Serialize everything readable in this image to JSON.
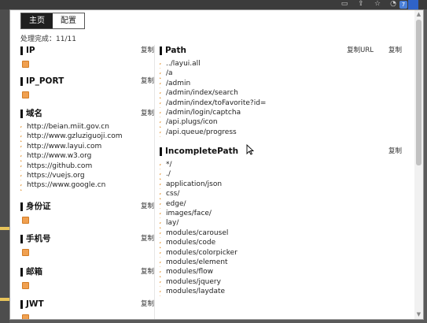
{
  "tabs": [
    {
      "label": "主页",
      "active": true
    },
    {
      "label": "配置",
      "active": false
    }
  ],
  "progress": "处理完成：11/11",
  "copy_label": "复制",
  "copy_url_label": "复制URL",
  "browser_strip": {
    "badge": "7",
    "icons": [
      "extension-icon",
      "share-icon",
      "star-icon",
      "profile-icon"
    ]
  },
  "left_sections": [
    {
      "title": "IP",
      "items": []
    },
    {
      "title": "IP_PORT",
      "items": []
    },
    {
      "title": "域名",
      "items": [
        "http://beian.miit.gov.cn",
        "http://www.gzluziguoji.com",
        "http://www.layui.com",
        "http://www.w3.org",
        "https://github.com",
        "https://vuejs.org",
        "https://www.google.cn"
      ]
    },
    {
      "title": "身份证",
      "items": []
    },
    {
      "title": "手机号",
      "items": []
    },
    {
      "title": "邮箱",
      "items": []
    },
    {
      "title": "JWT",
      "items": []
    }
  ],
  "right_sections": [
    {
      "title": "Path",
      "has_copy_url": true,
      "items": [
        "../layui.all",
        "/a",
        "/admin",
        "/admin/index/search",
        "/admin/index/toFavorite?id=",
        "/admin/login/captcha",
        "/api.plugs/icon",
        "/api.queue/progress"
      ]
    },
    {
      "title": "IncompletePath",
      "has_copy_url": false,
      "items": [
        "*/",
        "./",
        "application/json",
        "css/",
        "edge/",
        "images/face/",
        "lay/",
        "modules/carousel",
        "modules/code",
        "modules/colorpicker",
        "modules/element",
        "modules/flow",
        "modules/jquery",
        "modules/laydate"
      ]
    }
  ],
  "colors": {
    "accent": "#e08a1e",
    "active_tab": "#1f1f1f",
    "empty_marker": "#f0a050"
  }
}
